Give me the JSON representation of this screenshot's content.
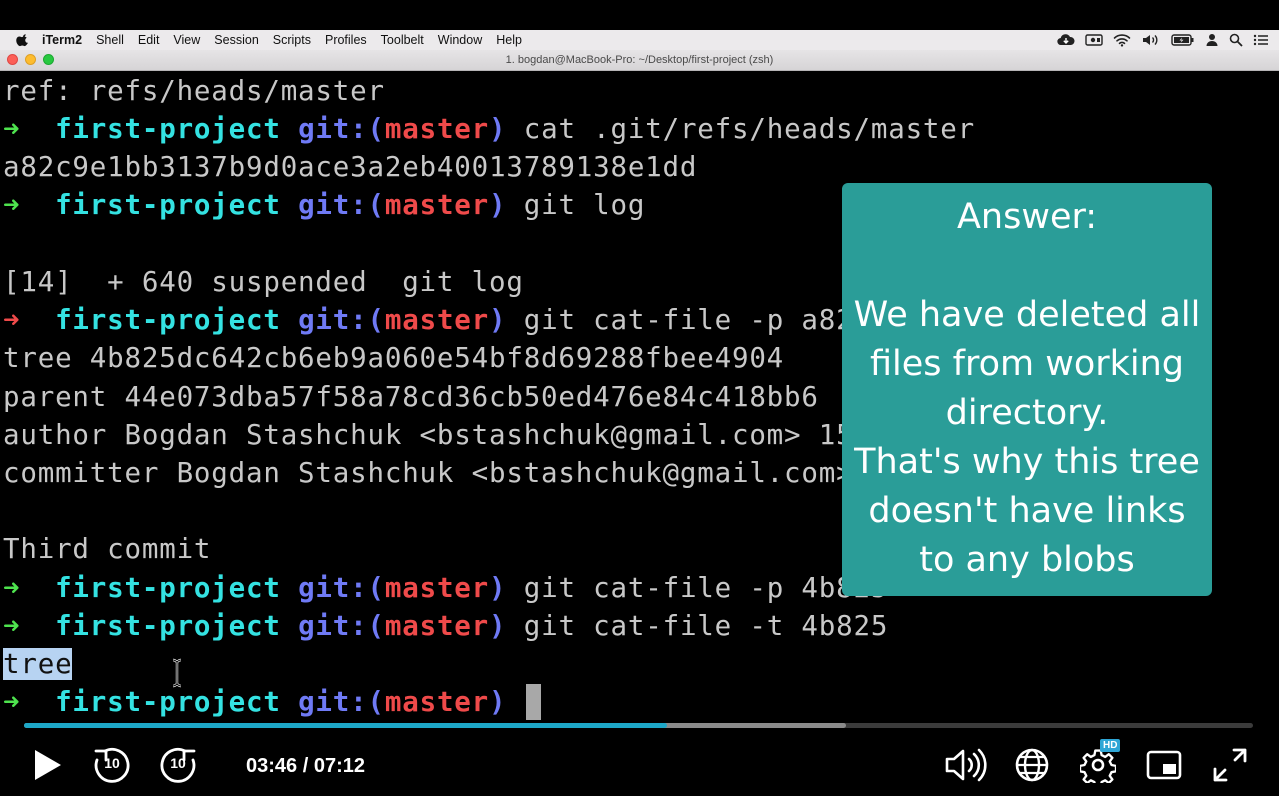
{
  "menubar": {
    "items": [
      "iTerm2",
      "Shell",
      "Edit",
      "View",
      "Session",
      "Scripts",
      "Profiles",
      "Toolbelt",
      "Window",
      "Help"
    ]
  },
  "window": {
    "title": "1. bogdan@MacBook-Pro: ~/Desktop/first-project (zsh)"
  },
  "terminal": {
    "line0": "ref: refs/heads/master",
    "hash_line": "a82c9e1bb3137b9d0ace3a2eb40013789138e1dd",
    "suspended": "[14]  + 640 suspended  git log",
    "tree_line": "tree 4b825dc642cb6eb9a060e54bf8d69288fbee4904",
    "parent_line": "parent 44e073dba57f58a78cd36cb50ed476e84c418bb6",
    "author_line": "author Bogdan Stashchuk <bstashchuk@gmail.com> 156",
    "committer_line": "committer Bogdan Stashchuk <bstashchuk@gmail.com>",
    "message_line": "Third commit",
    "selected_output": "tree",
    "prompt": {
      "arrow": "➜",
      "dir": "first-project",
      "git_open": "git:(",
      "branch": "master",
      "git_close": ")"
    },
    "commands": [
      "cat .git/refs/heads/master",
      "git log",
      "git cat-file -p a82c",
      "git cat-file -p 4b825",
      "git cat-file -t 4b825"
    ]
  },
  "answer_box": {
    "heading": "Answer:",
    "lines": [
      "We have deleted all",
      "files from working",
      "directory.",
      "That's why this tree",
      "doesn't have links",
      "to any blobs"
    ]
  },
  "player": {
    "time": "03:46 / 07:12",
    "rewind_label": "10",
    "forward_label": "10",
    "hd_badge": "HD",
    "progress_fraction": 0.523,
    "buffered_fraction": 0.669
  },
  "colors": {
    "prompt_arrow_ok": "#4ee34e",
    "prompt_arrow_err": "#ef4a4a",
    "dir": "#34e2e2",
    "git_label": "#6f7af5",
    "branch": "#ef4a4a",
    "answer_bg": "#2a9d98",
    "progress_played": "#1da7c7"
  }
}
